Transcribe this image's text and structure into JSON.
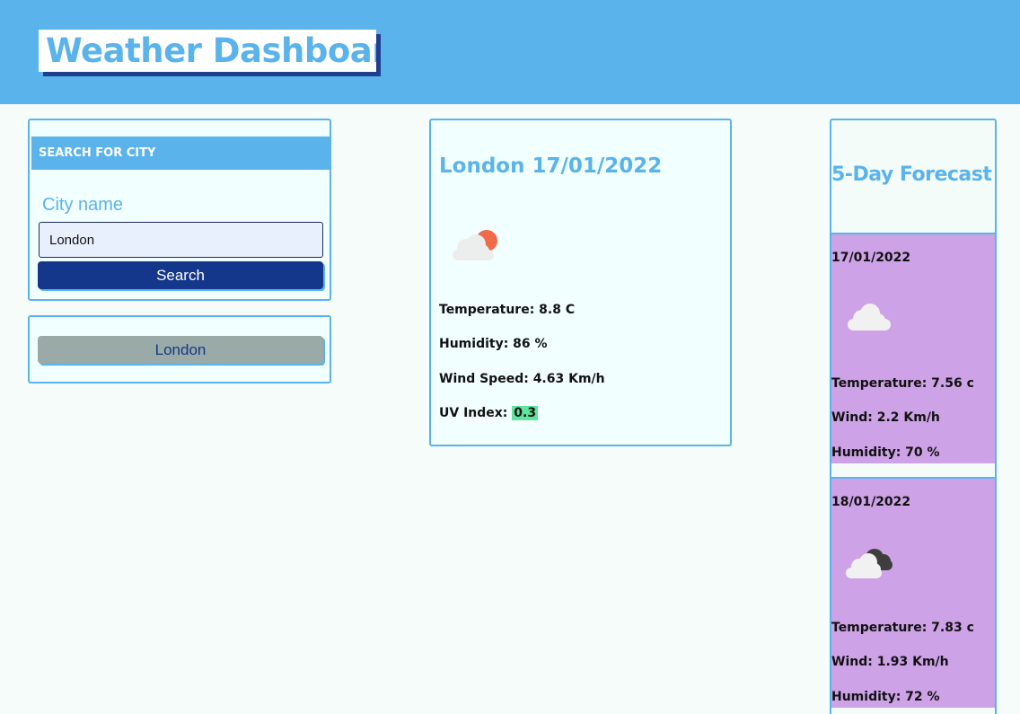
{
  "header": {
    "title": "Weather Dashboard"
  },
  "search": {
    "heading": "SEARCH FOR CITY",
    "label": "City name",
    "input_value": "London",
    "button_label": "Search"
  },
  "history": {
    "items": [
      {
        "label": "London"
      }
    ]
  },
  "current": {
    "title": "London 17/01/2022",
    "icon": "cloud-sun-icon",
    "temperature": "Temperature: 8.8 C",
    "humidity": "Humidity: 86 %",
    "wind": "Wind Speed: 4.63 Km/h",
    "uv_label": "UV Index:",
    "uv_value": "0.3",
    "uv_color": "#5fe39d"
  },
  "forecast": {
    "title": "5-Day Forecast",
    "days": [
      {
        "date": "17/01/2022",
        "icon": "cloud-icon",
        "temperature": "Temperature: 7.56 c",
        "wind": "Wind: 2.2 Km/h",
        "humidity": "Humidity: 70 %"
      },
      {
        "date": "18/01/2022",
        "icon": "broken-clouds-icon",
        "temperature": "Temperature: 7.83 c",
        "wind": "Wind: 1.93 Km/h",
        "humidity": "Humidity: 72 %"
      }
    ]
  },
  "colors": {
    "accent": "#5ab3ea",
    "button": "#14378b",
    "history_button": "#9aaba7",
    "forecast_card": "#cda2e6",
    "background": "#f6fcf9"
  }
}
